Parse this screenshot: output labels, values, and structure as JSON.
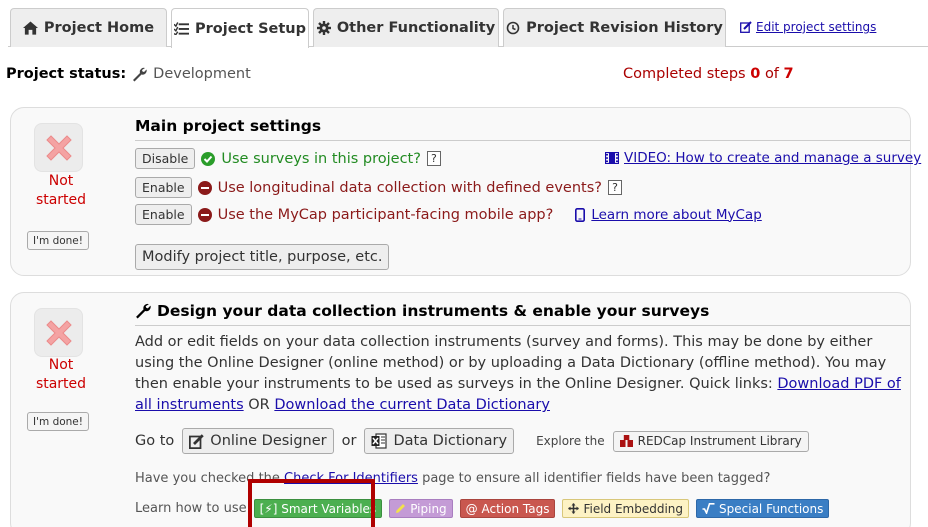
{
  "tabs": [
    {
      "label": "Project Home",
      "icon": "home-icon"
    },
    {
      "label": "Project Setup",
      "icon": "list-icon"
    },
    {
      "label": "Other Functionality",
      "icon": "gear-icon"
    },
    {
      "label": "Project Revision History",
      "icon": "history-icon"
    }
  ],
  "edit_settings_link": "Edit project settings",
  "project_status": {
    "label": "Project status:",
    "value": "Development"
  },
  "completed": {
    "prefix": "Completed steps",
    "done": "0",
    "of": "of",
    "total": "7"
  },
  "step1": {
    "status": [
      "Not",
      "started"
    ],
    "done_label": "I'm done!",
    "title": "Main project settings",
    "rows": [
      {
        "button": "Disable",
        "text": "Use surveys in this project?",
        "state": "on"
      },
      {
        "button": "Enable",
        "text": "Use longitudinal data collection with defined events?",
        "state": "off"
      },
      {
        "button": "Enable",
        "text": "Use the MyCap participant-facing mobile app?",
        "state": "off",
        "link": "Learn more about MyCap"
      }
    ],
    "qmark": "?",
    "video_link": "VIDEO: How to create and manage a survey",
    "modify_button": "Modify project title, purpose, etc."
  },
  "step2": {
    "status": [
      "Not",
      "started"
    ],
    "done_label": "I'm done!",
    "title": "Design your data collection instruments & enable your surveys",
    "paragraph": "Add or edit fields on your data collection instruments (survey and forms). This may be done by either using the Online Designer (online method) or by uploading a Data Dictionary (offline method). You may then enable your instruments to be used as surveys in the Online Designer. Quick links: ",
    "pdf_link": "Download PDF of all instruments",
    "or": " OR ",
    "dict_link": "Download the current Data Dictionary",
    "goto_label": "Go to",
    "online_designer": "Online Designer",
    "or_small": "or",
    "data_dictionary": "Data Dictionary",
    "explore_label": "Explore the",
    "library_button": "REDCap Instrument Library",
    "checked_prefix": "Have you checked the ",
    "identifiers_link": "Check For Identifiers",
    "checked_suffix": " page to ensure all identifier fields have been tagged?",
    "learn_label": "Learn how to use",
    "chips": {
      "smart_variables": "[⚡] Smart Variables",
      "piping": "Piping",
      "action_tags": "@ Action Tags",
      "field_embedding": "Field Embedding",
      "special_functions": "Special Functions"
    }
  },
  "colors": {
    "not_started": "#cc0000",
    "highlight": "#b00000"
  }
}
